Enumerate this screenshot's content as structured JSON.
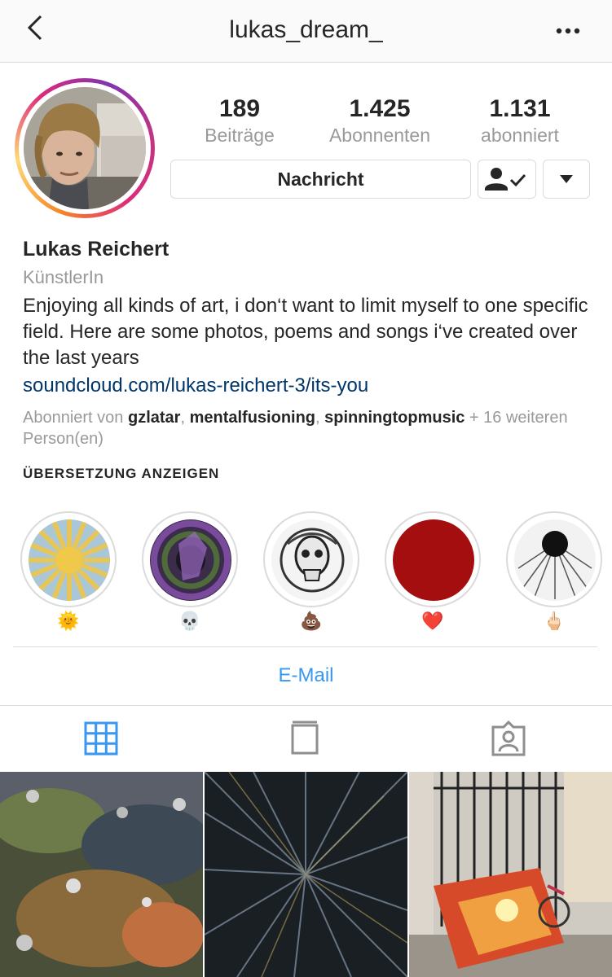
{
  "header": {
    "username": "lukas_dream_",
    "back_icon": "chevron-left-icon",
    "more_icon": "more-horizontal-icon"
  },
  "stats": [
    {
      "value": "189",
      "label": "Beiträge"
    },
    {
      "value": "1.425",
      "label": "Abonnenten"
    },
    {
      "value": "1.131",
      "label": "abonniert"
    }
  ],
  "actions": {
    "message_label": "Nachricht",
    "following_icon": "user-check-icon",
    "dropdown_icon": "caret-down-icon"
  },
  "profile": {
    "name": "Lukas Reichert",
    "category": "KünstlerIn",
    "bio": "Enjoying all kinds of art, i don‘t want to limit myself to one specific field. Here are some photos, poems and songs i‘ve created over the last years",
    "link": "soundcloud.com/lukas-reichert-3/its-you",
    "followed_by": {
      "prefix": "Abonniert von ",
      "users": [
        "gzlatar",
        "mentalfusioning",
        "spinningtopmusic"
      ],
      "suffix": " + 16 weiteren Person(en)"
    },
    "translate_label": "ÜBERSETZUNG ANZEIGEN"
  },
  "highlights": [
    {
      "emoji": "🌞"
    },
    {
      "emoji": "💀"
    },
    {
      "emoji": "💩"
    },
    {
      "emoji": "❤️"
    },
    {
      "emoji": "🖕🏻"
    }
  ],
  "contact": {
    "email_label": "E-Mail"
  },
  "tabs": [
    {
      "icon": "grid-icon",
      "active": true
    },
    {
      "icon": "feed-icon",
      "active": false
    },
    {
      "icon": "tagged-icon",
      "active": false
    }
  ],
  "colors": {
    "link": "#003569",
    "email": "#3897f0",
    "active_tab": "#3897f0",
    "muted": "#999999"
  }
}
